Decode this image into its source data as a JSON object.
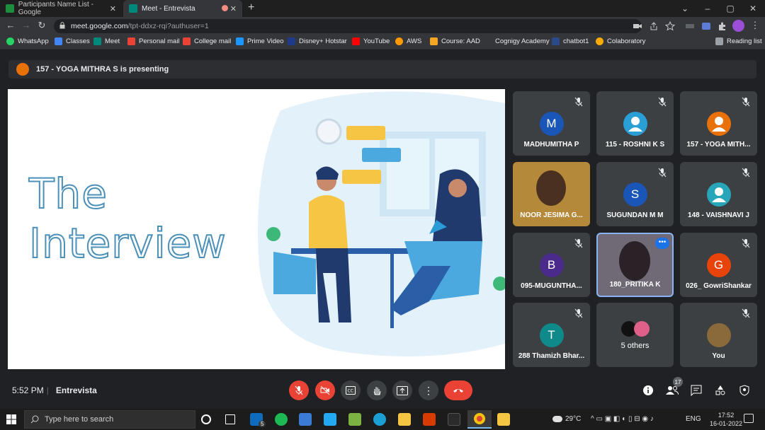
{
  "browser": {
    "tabs": [
      {
        "title": "Participants Name List - Google",
        "active": false
      },
      {
        "title": "Meet - Entrevista",
        "active": true
      }
    ],
    "url_host": "meet.google.com",
    "url_path": "/tpt-ddxz-rqi?authuser=1",
    "bookmarks": [
      "WhatsApp",
      "Classes",
      "Meet",
      "Personal mail",
      "College mail",
      "Prime Video",
      "Disney+ Hotstar",
      "YouTube",
      "AWS",
      "Course: AAD",
      "Cognigy Academy",
      "chatbot1",
      "Colaboratory"
    ],
    "reading_list": "Reading list"
  },
  "meet": {
    "presenting_text": "157 - YOGA MITHRA S is presenting",
    "slide": {
      "title_line1": "The",
      "title_line2": "Interview"
    },
    "participants": [
      {
        "name": "MADHUMITHA P",
        "initial": "M",
        "color": "#1a56b8",
        "kind": "initial"
      },
      {
        "name": "115 - ROSHNI K S",
        "initial": "",
        "color": "#2a9fd6",
        "kind": "person"
      },
      {
        "name": "157 - YOGA MITH...",
        "initial": "",
        "color": "#e8710a",
        "kind": "person"
      },
      {
        "name": "NOOR JESIMA G...",
        "initial": "",
        "color": "#b5893a",
        "kind": "video"
      },
      {
        "name": "SUGUNDAN M M",
        "initial": "S",
        "color": "#1a56b8",
        "kind": "initial"
      },
      {
        "name": "148 - VAISHNAVI J",
        "initial": "",
        "color": "#26a6b8",
        "kind": "person"
      },
      {
        "name": "095-MUGUNTHA...",
        "initial": "B",
        "color": "#4a2a8a",
        "kind": "initial"
      },
      {
        "name": "180_PRITIKA K",
        "initial": "",
        "color": "#6f6a76",
        "kind": "video"
      },
      {
        "name": "026_ GowriShankar",
        "initial": "G",
        "color": "#e8430a",
        "kind": "initial"
      },
      {
        "name": "288 Thamizh Bhar...",
        "initial": "T",
        "color": "#0f8a8a",
        "kind": "initial"
      },
      {
        "name": "5 others",
        "initial": "",
        "color": "#e0608a",
        "kind": "others"
      },
      {
        "name": "You",
        "initial": "",
        "color": "#8a6a3a",
        "kind": "photo"
      }
    ],
    "time": "5:52 PM",
    "meeting_name": "Entrevista",
    "people_count": "17"
  },
  "taskbar": {
    "search_placeholder": "Type here to search",
    "mail_badge": "5",
    "weather": "29°C",
    "lang": "ENG",
    "clock_time": "17:52",
    "clock_date": "16-01-2022"
  },
  "colors": {
    "accent": "#8ab4f8",
    "end_call": "#ea4335",
    "present_bar": "#2d2e31"
  }
}
